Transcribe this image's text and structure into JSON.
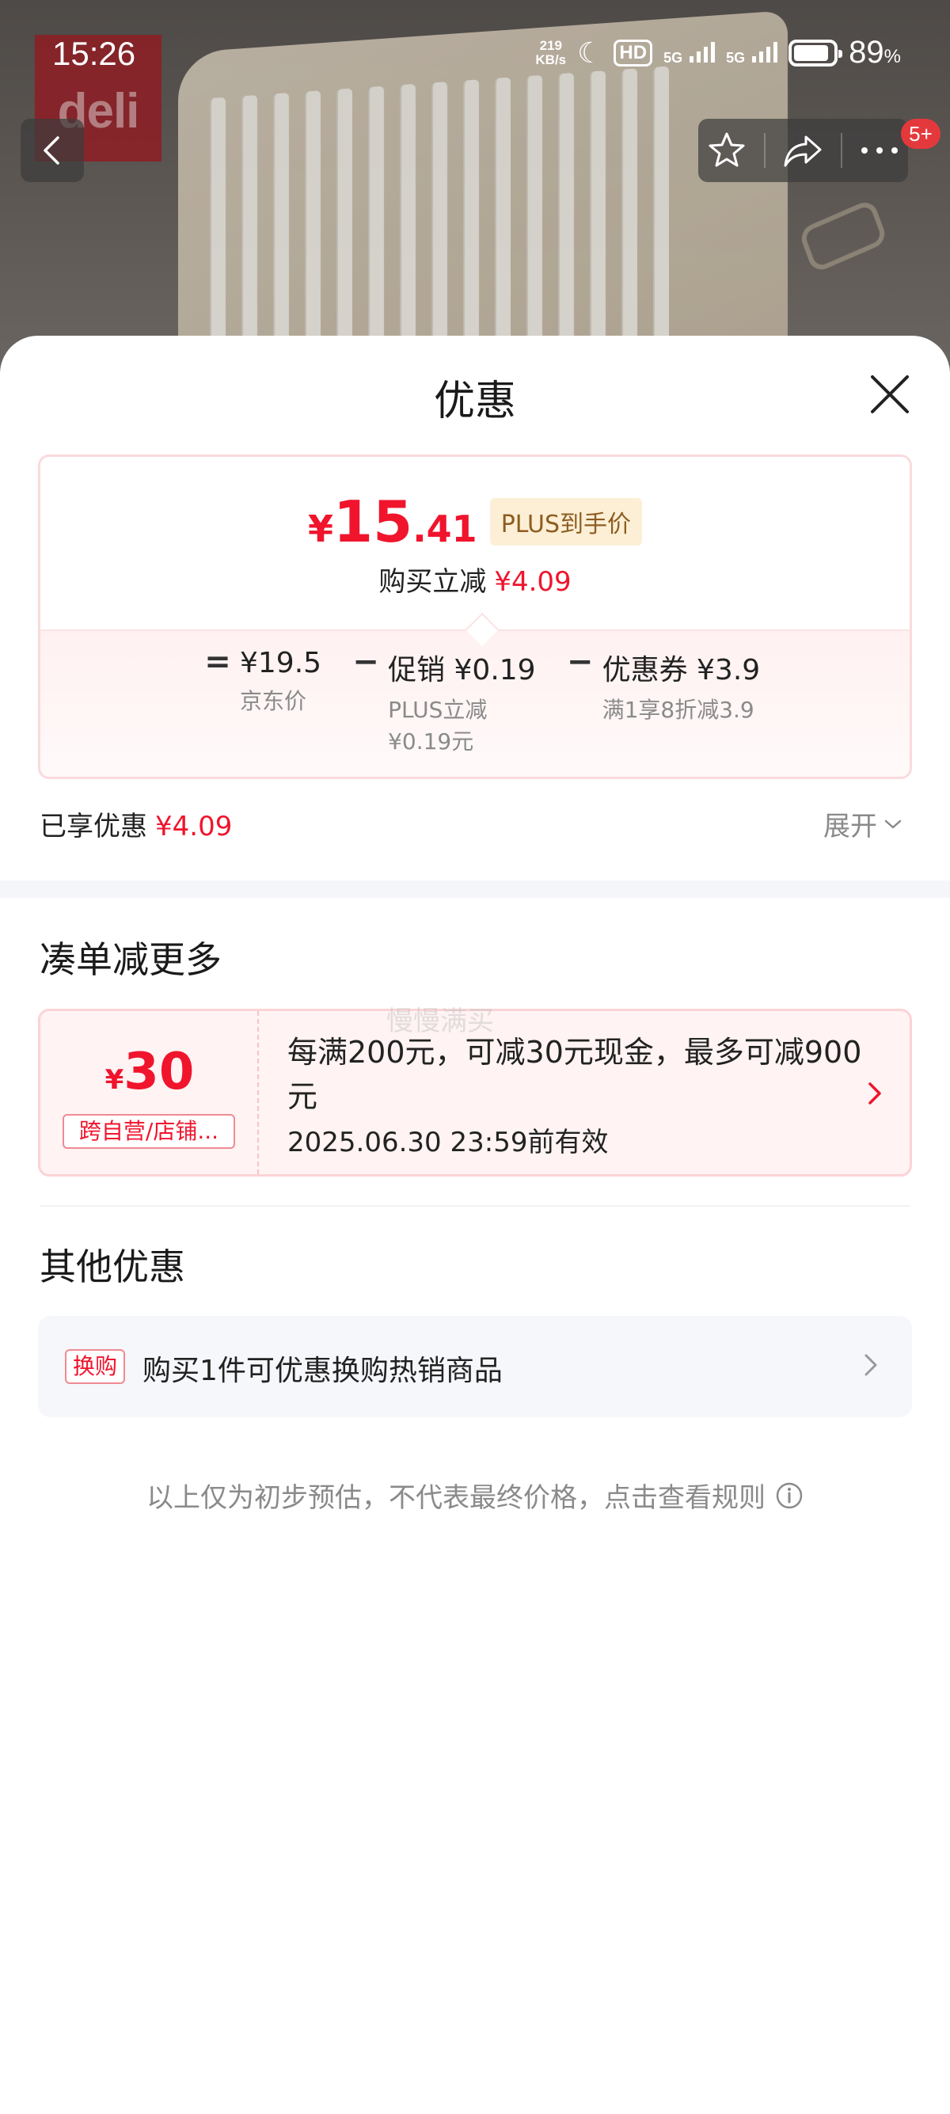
{
  "status_bar": {
    "time": "15:26",
    "speed_value": "219",
    "speed_unit": "KB/s",
    "hd_label": "HD",
    "net1": "5G",
    "net2": "5G",
    "battery_level": 0.89,
    "battery_pct": "89",
    "battery_unit": "%"
  },
  "product_photo": {
    "brand": "deli"
  },
  "nav": {
    "badge": "5+"
  },
  "sheet": {
    "title": "优惠",
    "price": {
      "currency": "¥",
      "integer": "15",
      "decimal": ".41",
      "plus_label": "PLUS到手价",
      "reduce_label": "购买立减",
      "reduce_amount": "¥4.09"
    },
    "formula": {
      "equals": "=",
      "minus": "−",
      "terms": [
        {
          "main": "¥19.5",
          "sub": "京东价"
        },
        {
          "main": "促销 ¥0.19",
          "sub": "PLUS立减\n¥0.19元"
        },
        {
          "main": "优惠券 ¥3.9",
          "sub": "满1享8折减3.9"
        }
      ]
    },
    "enjoyed": {
      "label": "已享优惠",
      "amount": "¥4.09"
    },
    "expand_label": "展开",
    "section_more": "凑单减更多",
    "coupon": {
      "currency": "¥",
      "amount": "30",
      "tag": "跨自营/店铺...",
      "description": "每满200元，可减30元现金，最多可减900元",
      "validity": "2025.06.30 23:59前有效"
    },
    "watermark": "慢慢满买",
    "section_other": "其他优惠",
    "exchange": {
      "tag": "换购",
      "text": "购买1件可优惠换购热销商品"
    },
    "disclaimer": "以上仅为初步预估，不代表最终价格，点击查看规则"
  },
  "colors": {
    "accent_red": "#f0142d",
    "plus_gold_bg": "#fcefd6",
    "sheet_bg": "#ffffff"
  }
}
